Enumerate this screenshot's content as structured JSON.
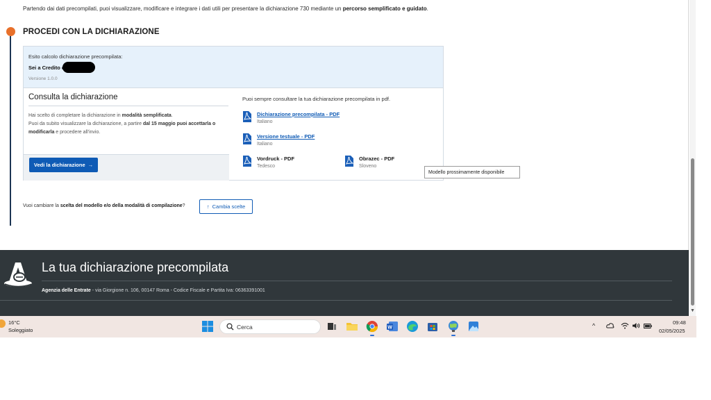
{
  "intro": {
    "text_before": "Partendo dai dati precompilati, puoi visualizzare, modificare e integrare i dati utili per presentare la dichiarazione 730 mediante un ",
    "text_bold": "percorso semplificato e guidato",
    "text_after": "."
  },
  "section": {
    "title": "PROCEDI CON LA DICHIARAZIONE"
  },
  "esito": {
    "label": "Esito calcolo dichiarazione precompilata:",
    "value": "Sei a Credito di",
    "version": "Versione 1.0.0"
  },
  "consulta": {
    "title": "Consulta la dichiarazione",
    "p1_before": "Hai scelto di completare la dichiarazione in ",
    "p1_bold": "modalità semplificata",
    "p1_after": ".",
    "p2_before": "Puoi da subito visualizzare la dichiarazione, a partire ",
    "p2_bold": "dal 15 maggio puoi accettarla o modificarla",
    "p2_after": " e procedere all'invio.",
    "button_label": "Vedi la dichiarazione",
    "button_arrow": "→"
  },
  "pdfs": {
    "note": "Puoi sempre consultare la tua dichiarazione precompilata in pdf.",
    "items": [
      {
        "title": "Dichiarazione precompilata - PDF",
        "lang": "Italiano"
      },
      {
        "title": "Versione testuale - PDF",
        "lang": "Italiano"
      },
      {
        "title": "Vordruck - PDF",
        "lang": "Tedesco"
      },
      {
        "title": "Obrazec - PDF",
        "lang": "Sloveno"
      }
    ]
  },
  "tooltip": {
    "text": "Modello prossimamente disponibile"
  },
  "change": {
    "before": "Vuoi cambiare la ",
    "bold": "scelta del modello e/o della modalità di compilazione",
    "after": "?",
    "button_icon": "↑",
    "button_label": "Cambia scelte"
  },
  "footer": {
    "title": "La tua dichiarazione precompilata",
    "agency": "Agenzia delle Entrate",
    "address": " - via Giorgione n. 106, 00147 Roma - Codice Fiscale e Partita Iva: 06363391001"
  },
  "taskbar": {
    "weather_temp": "16°C",
    "weather_desc": "Soleggiato",
    "search_label": "Cerca",
    "tray_chevron": "^",
    "time": "09:48",
    "date": "02/05/2025"
  },
  "colors": {
    "accent": "#0f5bb5",
    "timeline_dot": "#e8702a",
    "footer_bg": "#30373b",
    "pdf_icon": "#1b5fb8"
  }
}
